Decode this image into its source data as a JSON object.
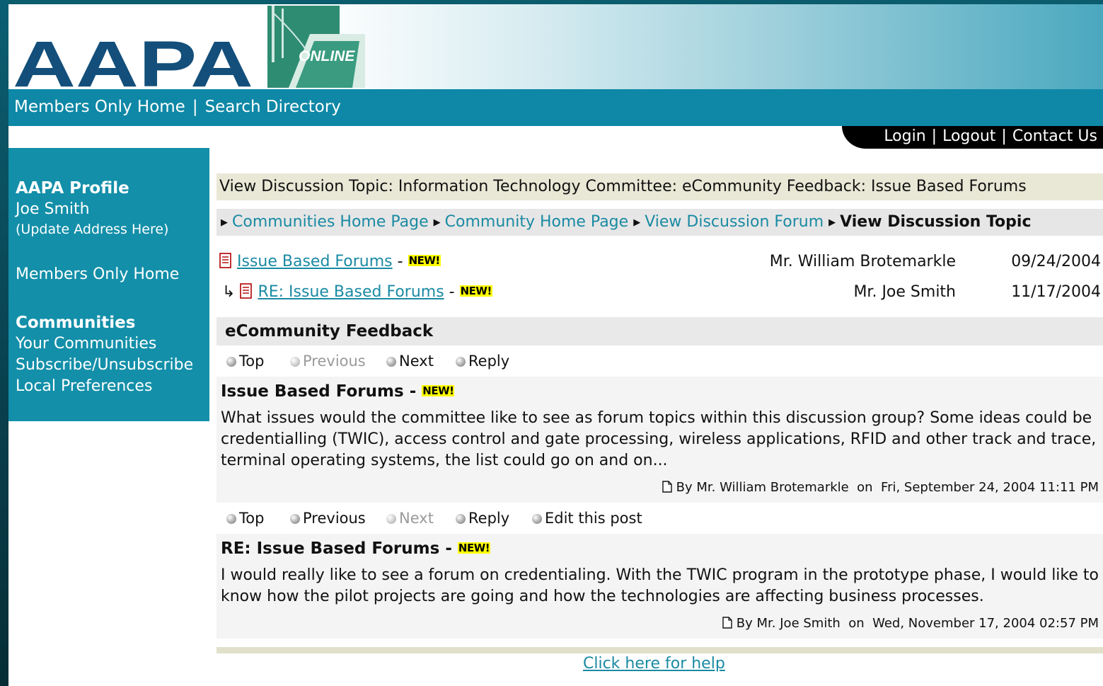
{
  "header": {
    "logo_text": "AAPA",
    "online_badge": "ONLINE",
    "nav": [
      "Members Only Home",
      "Search Directory"
    ],
    "nav_separator": "|",
    "account_links": [
      "Login",
      "Logout",
      "Contact Us"
    ]
  },
  "sidebar": {
    "profile_heading": "AAPA Profile",
    "user_name": "Joe Smith",
    "update_address": "(Update Address Here)",
    "members_home": "Members Only Home",
    "communities_heading": "Communities",
    "communities_links": [
      "Your Communities",
      "Subscribe/Unsubscribe",
      "Local Preferences"
    ]
  },
  "topic": {
    "header": "View Discussion Topic: Information Technology Committee: eCommunity Feedback: Issue Based Forums",
    "breadcrumbs": [
      "Communities Home Page",
      "Community Home Page",
      "View Discussion Forum"
    ],
    "breadcrumb_current": "View Discussion Topic",
    "new_badge": "NEW!",
    "dash": "-",
    "reply_arrow": "↳",
    "threads": [
      {
        "title": "Issue Based Forums",
        "author": "Mr. William Brotemarkle",
        "date": "09/24/2004"
      },
      {
        "title": "RE: Issue Based Forums",
        "author": "Mr. Joe Smith",
        "date": "11/17/2004"
      }
    ],
    "section_title": "eCommunity Feedback"
  },
  "actions_1": [
    {
      "label": "Top",
      "enabled": true
    },
    {
      "label": "Previous",
      "enabled": false
    },
    {
      "label": "Next",
      "enabled": true
    },
    {
      "label": "Reply",
      "enabled": true
    }
  ],
  "actions_2": [
    {
      "label": "Top",
      "enabled": true
    },
    {
      "label": "Previous",
      "enabled": true
    },
    {
      "label": "Next",
      "enabled": false
    },
    {
      "label": "Reply",
      "enabled": true
    },
    {
      "label": "Edit this post",
      "enabled": true
    }
  ],
  "posts": [
    {
      "title": "Issue Based Forums",
      "body": "What issues would the committee like to see as forum topics within this discussion group? Some ideas could be credentialling (TWIC), access control and gate processing, wireless applications, RFID and other track and trace, terminal operating systems, the list could go on and on...",
      "meta": "By Mr. William Brotemarkle  on  Fri, September 24, 2004 11:11 PM"
    },
    {
      "title": "RE: Issue Based Forums",
      "body": "I would really like to see a forum on credentialing. With the TWIC program in the prototype phase, I would like to know how the pilot projects are going and how the technologies are affecting business processes.",
      "meta": "By Mr. Joe Smith  on  Wed, November 17, 2004 02:57 PM"
    }
  ],
  "help_link": "Click here for help",
  "colors": {
    "teal_nav": "#0e88a6",
    "sidebar": "#138fa9",
    "link": "#1a8aa3",
    "logo_navy": "#134f7a",
    "logo_green": "#2a8a6e"
  }
}
